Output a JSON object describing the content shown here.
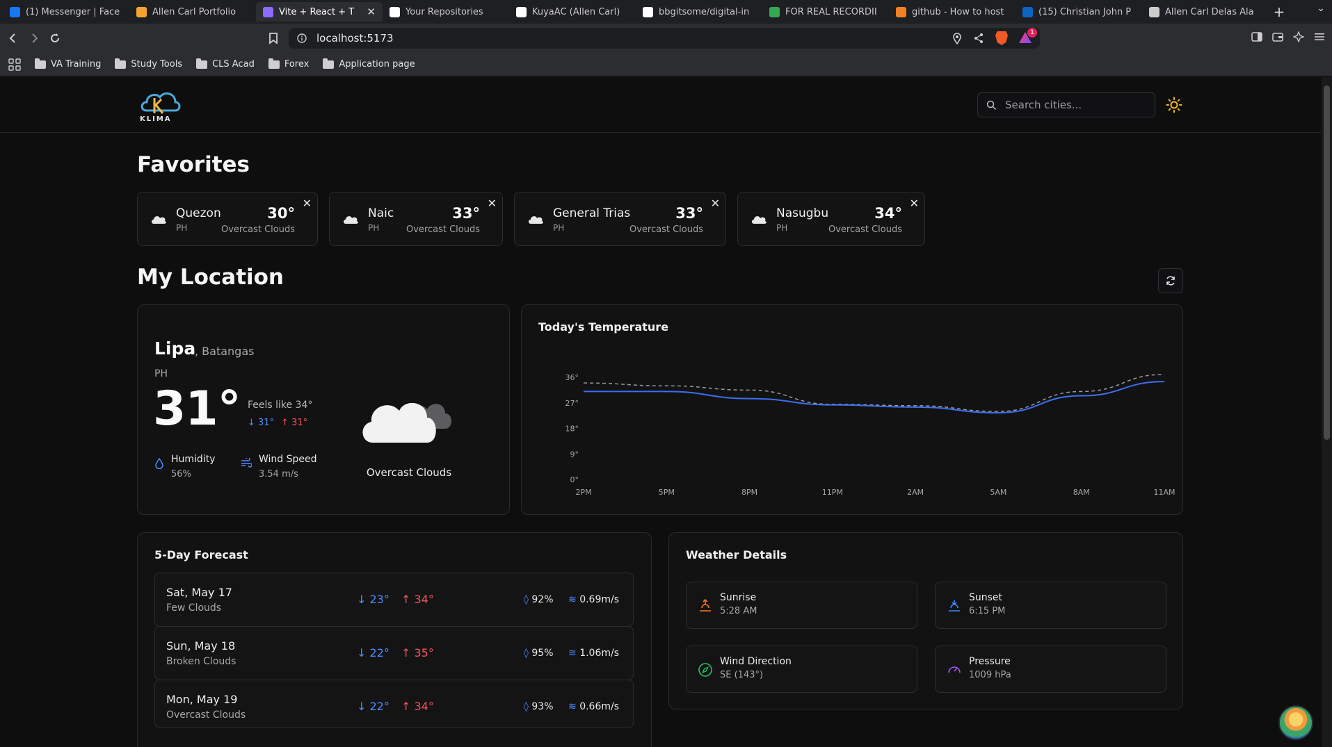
{
  "browser": {
    "tabs": [
      {
        "label": "(1) Messenger | Face",
        "favicon": "facebook-icon",
        "color": "#1877f2"
      },
      {
        "label": "Allen Carl Portfolio",
        "favicon": "portfolio-icon",
        "color": "#f4a531"
      },
      {
        "label": "Vite + React + T",
        "favicon": "vite-icon",
        "color": "#8c6cff",
        "active": true
      },
      {
        "label": "Your Repositories",
        "favicon": "github-icon",
        "color": "#ffffff"
      },
      {
        "label": "KuyaAC (Allen Carl)",
        "favicon": "github-icon",
        "color": "#ffffff"
      },
      {
        "label": "bbgitsome/digital-in",
        "favicon": "github-icon",
        "color": "#ffffff"
      },
      {
        "label": "FOR REAL RECORDII",
        "favicon": "drive-icon",
        "color": "#34a853"
      },
      {
        "label": "github - How to host",
        "favicon": "stackoverflow-icon",
        "color": "#f48024"
      },
      {
        "label": "(15) Christian John P",
        "favicon": "linkedin-icon",
        "color": "#0a66c2"
      },
      {
        "label": "Allen Carl Delas Ala",
        "favicon": "globe-icon",
        "color": "#cccccc"
      }
    ],
    "url": "localhost:5173",
    "rewards_badge": "1",
    "bookmarks": [
      "VA Training",
      "Study Tools",
      "CLS Acad",
      "Forex",
      "Application page"
    ]
  },
  "app": {
    "logo_text": "KLIMA",
    "search_placeholder": "Search cities...",
    "favorites_title": "Favorites",
    "favorites": [
      {
        "city": "Quezon",
        "country": "PH",
        "temp": "30°",
        "desc": "Overcast Clouds"
      },
      {
        "city": "Naic",
        "country": "PH",
        "temp": "33°",
        "desc": "Overcast Clouds"
      },
      {
        "city": "General Trias",
        "country": "PH",
        "temp": "33°",
        "desc": "Overcast Clouds"
      },
      {
        "city": "Nasugbu",
        "country": "PH",
        "temp": "34°",
        "desc": "Overcast Clouds"
      }
    ],
    "location_title": "My Location",
    "current": {
      "city": "Lipa",
      "region": ", Batangas",
      "country": "PH",
      "temp": "31°",
      "feels_like": "Feels like 34°",
      "min": "31°",
      "max": "31°",
      "humidity_label": "Humidity",
      "humidity": "56%",
      "wind_label": "Wind Speed",
      "wind": "3.54 m/s",
      "description": "Overcast Clouds"
    },
    "forecast_title": "5-Day Forecast",
    "forecast": [
      {
        "day": "Sat, May 17",
        "desc": "Few Clouds",
        "min": "23°",
        "max": "34°",
        "humidity": "92%",
        "wind": "0.69m/s"
      },
      {
        "day": "Sun, May 18",
        "desc": "Broken Clouds",
        "min": "22°",
        "max": "35°",
        "humidity": "95%",
        "wind": "1.06m/s"
      },
      {
        "day": "Mon, May 19",
        "desc": "Overcast Clouds",
        "min": "22°",
        "max": "34°",
        "humidity": "93%",
        "wind": "0.66m/s"
      }
    ],
    "details_title": "Weather Details",
    "details": [
      {
        "label": "Sunrise",
        "value": "5:28 AM",
        "icon": "sunrise-icon",
        "color": "#f97316"
      },
      {
        "label": "Sunset",
        "value": "6:15 PM",
        "icon": "sunset-icon",
        "color": "#3b82f6"
      },
      {
        "label": "Wind Direction",
        "value": "SE (143°)",
        "icon": "compass-icon",
        "color": "#22c55e"
      },
      {
        "label": "Pressure",
        "value": "1009 hPa",
        "icon": "gauge-icon",
        "color": "#a855f7"
      }
    ]
  },
  "chart_data": {
    "type": "line",
    "title": "Today's Temperature",
    "x": [
      "2PM",
      "5PM",
      "8PM",
      "11PM",
      "2AM",
      "5AM",
      "8AM",
      "11AM"
    ],
    "ylim": [
      0,
      36
    ],
    "yticks": [
      "0°",
      "9°",
      "18°",
      "27°",
      "36°"
    ],
    "series": [
      {
        "values": [
          31,
          31,
          28.5,
          26.3,
          25.5,
          23.5,
          29.5,
          34.5
        ],
        "color": "#3b6ff0",
        "style": "solid"
      },
      {
        "values": [
          34,
          33,
          31.5,
          26.5,
          26,
          24,
          31,
          37
        ],
        "color": "#9a9a9e",
        "style": "dashed"
      }
    ]
  }
}
